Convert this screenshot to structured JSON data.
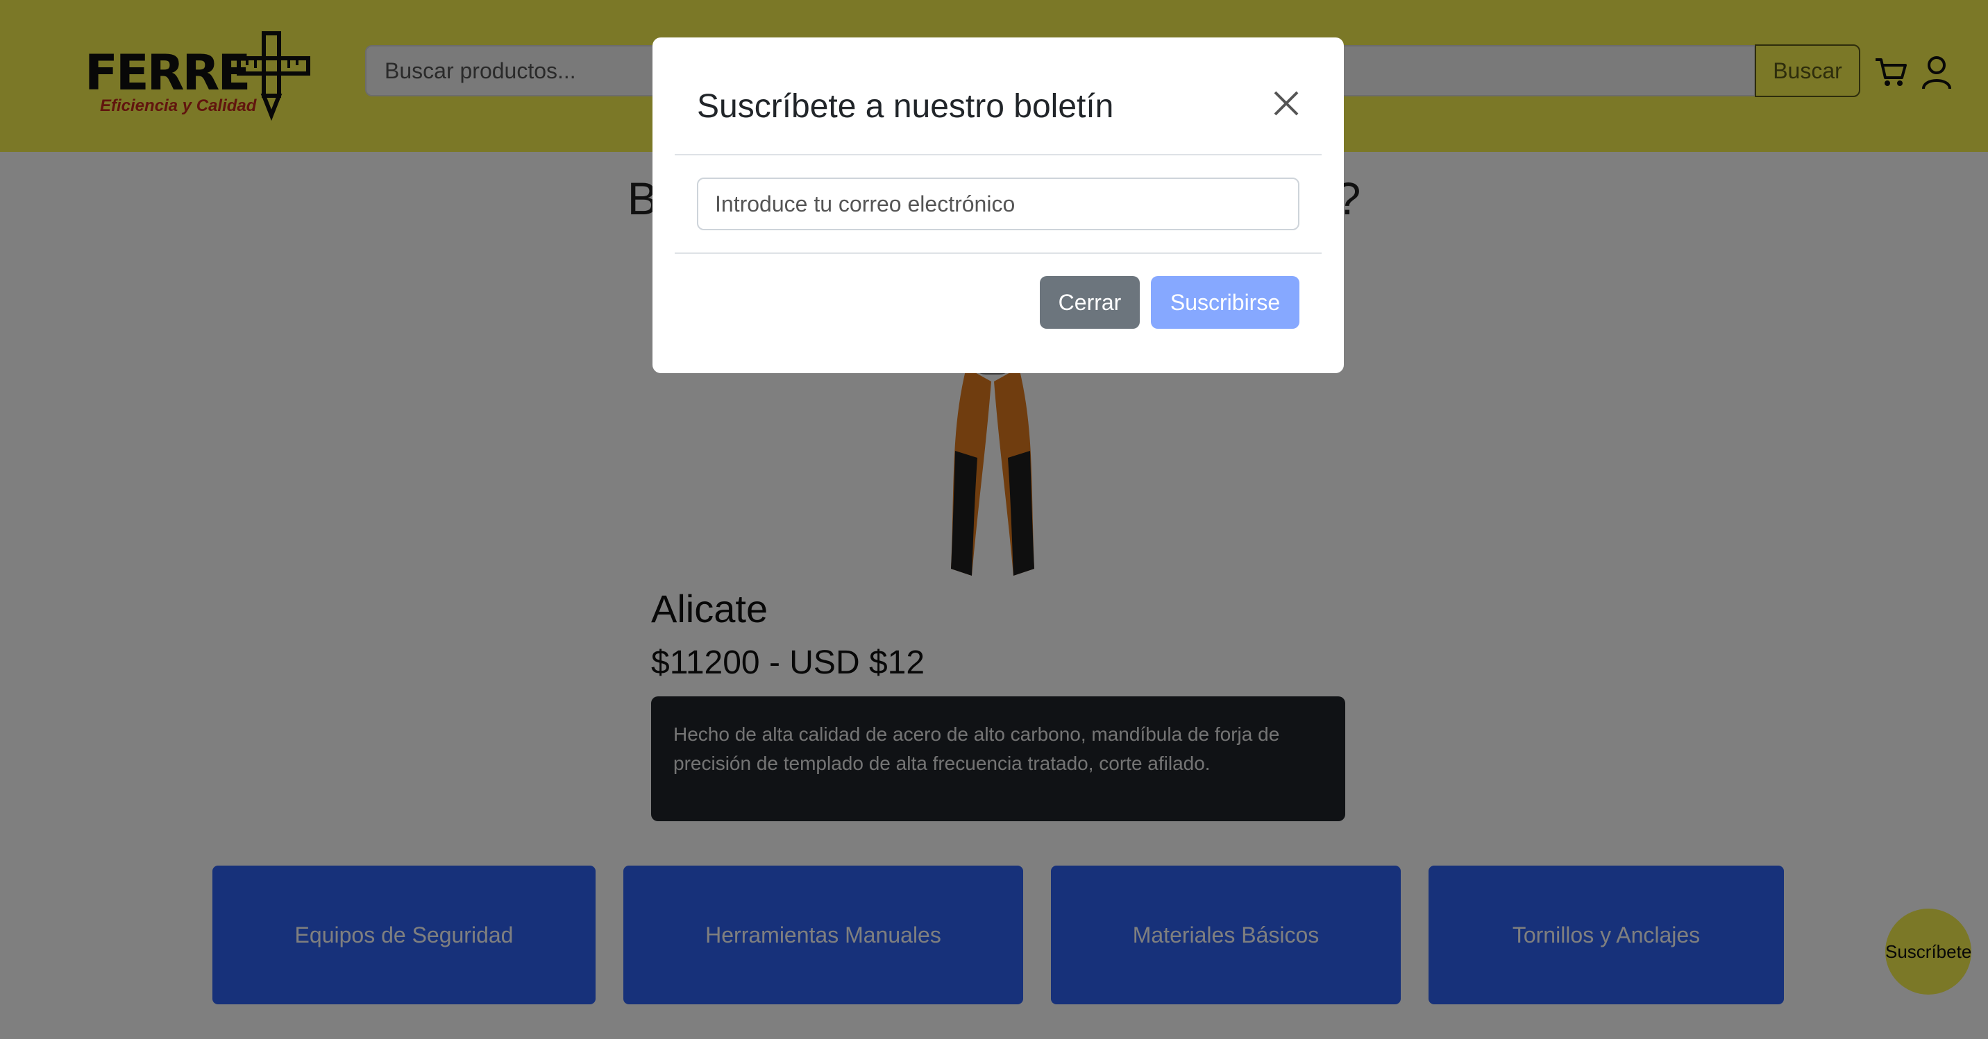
{
  "header": {
    "logo_title": "FERRE",
    "logo_subtitle": "Eficiencia y Calidad",
    "search_placeholder": "Buscar productos...",
    "search_button": "Buscar"
  },
  "welcome": "Bienvenido, ¿Qué deseas comprar?",
  "product": {
    "name": "Alicate",
    "price": "$11200 - USD $12",
    "description": "Hecho de alta calidad de acero de alto carbono, mandíbula de forja de precisión de templado de alta frecuencia tratado, corte afilado."
  },
  "categories": [
    "Equipos de Seguridad",
    "Herramientas Manuales",
    "Materiales Básicos",
    "Tornillos y Anclajes"
  ],
  "subscribe_fab": "Suscríbete",
  "modal": {
    "title": "Suscríbete a nuestro boletín",
    "email_placeholder": "Introduce tu correo electrónico",
    "close_button": "Cerrar",
    "subscribe_button": "Suscribirse"
  },
  "colors": {
    "header_bg": "#f6f04f",
    "category_bg": "#2f63f5",
    "description_bg": "#21252b",
    "primary_button": "#86a8ff",
    "secondary_button": "#6c757d"
  },
  "icons": [
    "ruler-pencil-logo-icon",
    "cart-icon",
    "user-icon",
    "close-icon"
  ]
}
